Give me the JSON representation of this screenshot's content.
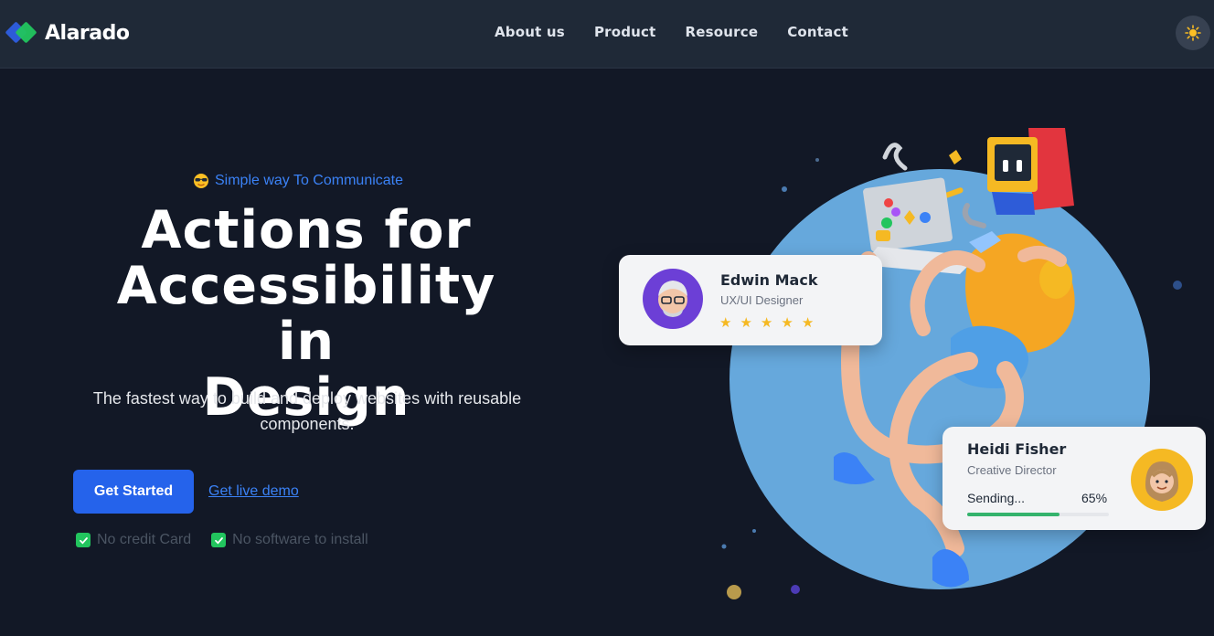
{
  "brand": {
    "name": "Alarado"
  },
  "nav": {
    "links": [
      {
        "label": "About us"
      },
      {
        "label": "Product"
      },
      {
        "label": "Resource"
      },
      {
        "label": "Contact"
      }
    ]
  },
  "theme_toggle": {
    "icon": "sun-icon"
  },
  "hero": {
    "tagline": "Simple way To Communicate",
    "headline_line1": "Actions for",
    "headline_line2": "Accessibility in",
    "headline_line3": "Design",
    "subtitle": "The fastest way to build and deploy websites with reusable components.",
    "primary_cta": "Get Started",
    "secondary_cta": "Get live demo",
    "features": [
      "No credit Card",
      "No software to install"
    ]
  },
  "cards": {
    "profile": {
      "name": "Edwin Mack",
      "role": "UX/UI Designer",
      "rating": 5
    },
    "status": {
      "name": "Heidi Fisher",
      "role": "Creative Director",
      "progress_label": "Sending...",
      "progress_value_text": "65%",
      "progress_fraction": 0.65
    }
  },
  "colors": {
    "background": "#121826",
    "navbar": "#1f2937",
    "accent": "#2563eb",
    "link": "#3b82f6",
    "success": "#22c55e",
    "circle": "#66a8dc"
  }
}
